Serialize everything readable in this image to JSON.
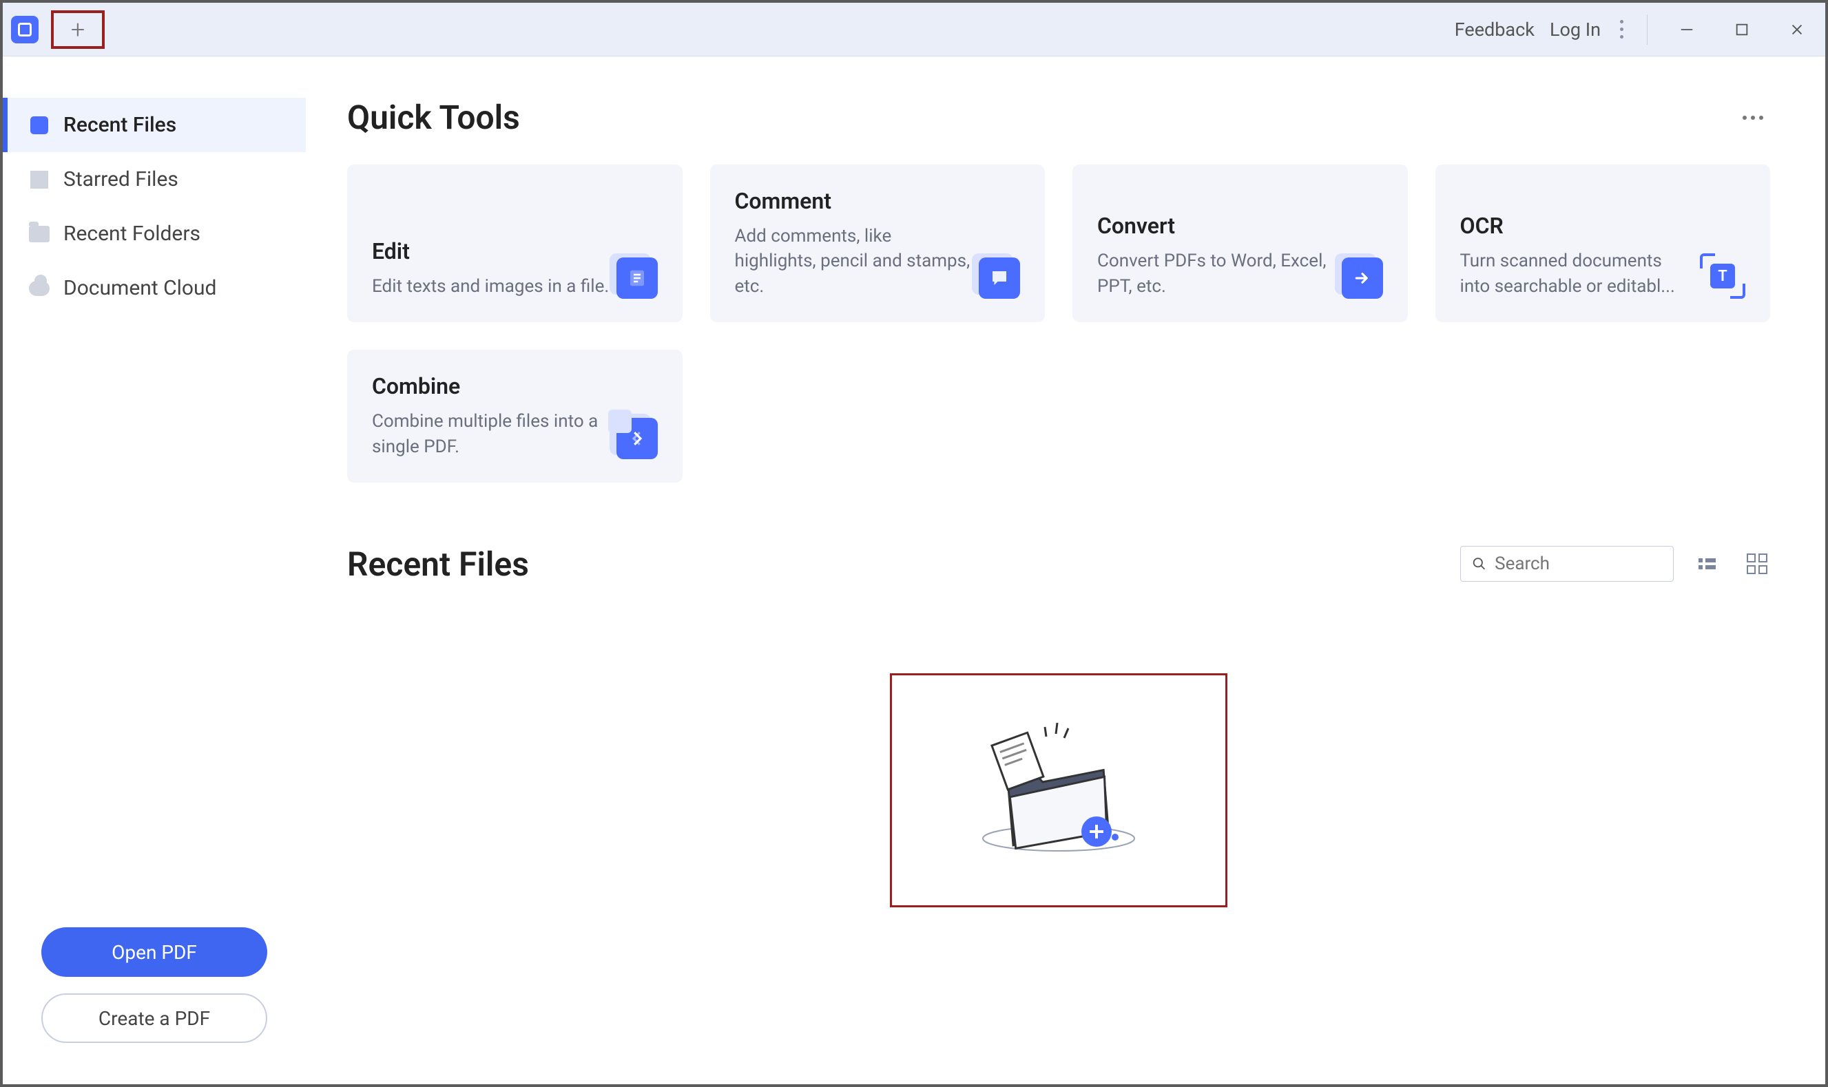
{
  "titlebar": {
    "feedback": "Feedback",
    "login": "Log In"
  },
  "sidebar": {
    "items": [
      {
        "key": "recent-files",
        "label": "Recent Files",
        "icon": "box",
        "active": true
      },
      {
        "key": "starred-files",
        "label": "Starred Files",
        "icon": "star",
        "active": false
      },
      {
        "key": "recent-folders",
        "label": "Recent Folders",
        "icon": "folder",
        "active": false
      },
      {
        "key": "document-cloud",
        "label": "Document Cloud",
        "icon": "cloud",
        "active": false
      }
    ],
    "open_pdf": "Open PDF",
    "create_pdf": "Create a PDF"
  },
  "main": {
    "quick_tools_title": "Quick Tools",
    "tools": [
      {
        "key": "edit",
        "title": "Edit",
        "desc": "Edit texts and images in a file.",
        "icon": "doc"
      },
      {
        "key": "comment",
        "title": "Comment",
        "desc": "Add comments, like highlights, pencil and stamps, etc.",
        "icon": "chat"
      },
      {
        "key": "convert",
        "title": "Convert",
        "desc": "Convert PDFs to Word, Excel, PPT, etc.",
        "icon": "arrow"
      },
      {
        "key": "ocr",
        "title": "OCR",
        "desc": "Turn scanned documents into searchable or editabl...",
        "icon": "ocr"
      },
      {
        "key": "combine",
        "title": "Combine",
        "desc": "Combine multiple files into a single PDF.",
        "icon": "combine"
      }
    ],
    "recent_files_title": "Recent Files",
    "search_placeholder": "Search"
  }
}
